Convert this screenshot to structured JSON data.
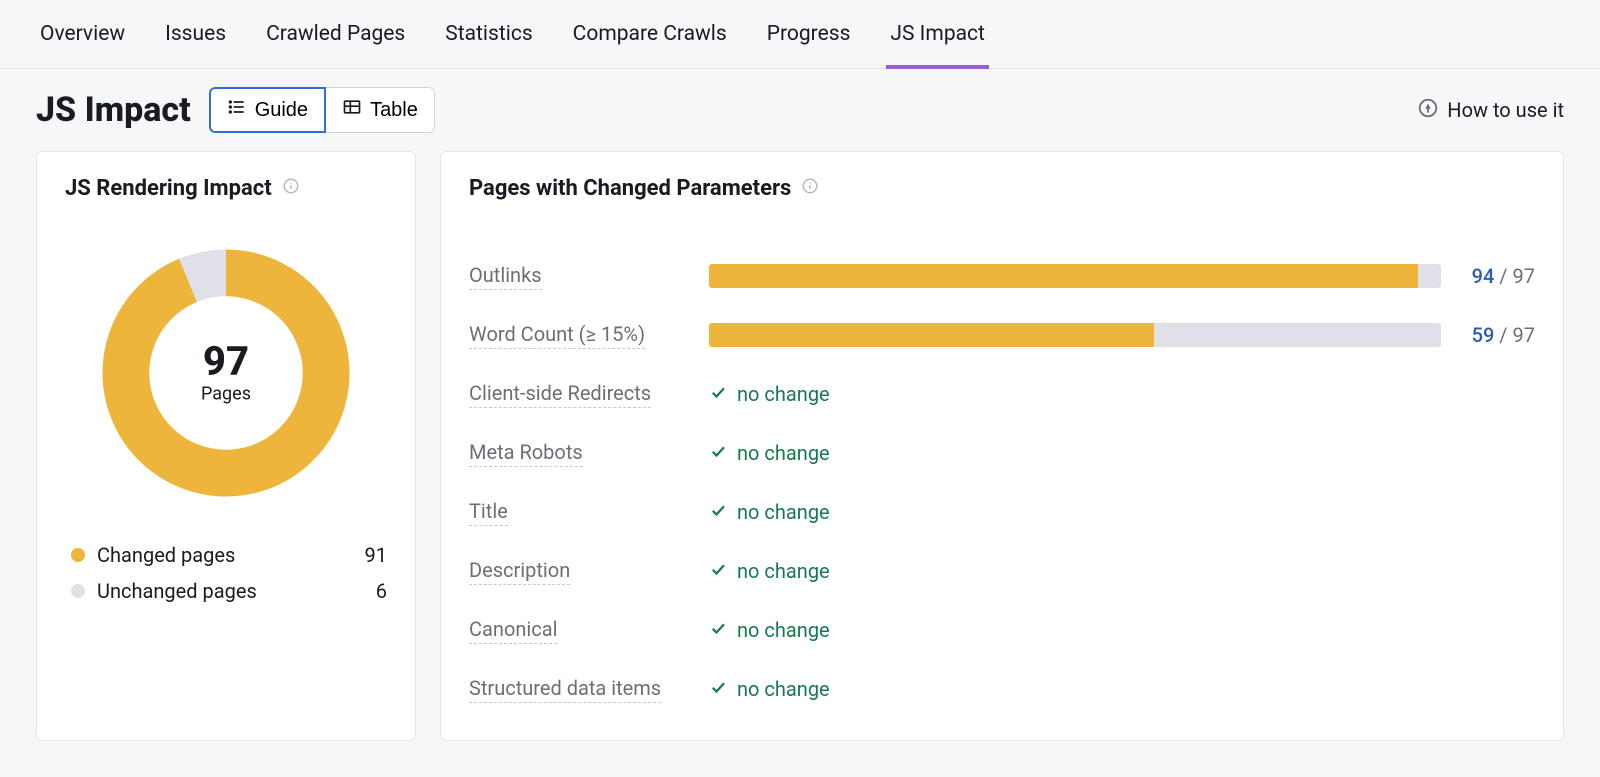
{
  "tabs": [
    {
      "label": "Overview"
    },
    {
      "label": "Issues"
    },
    {
      "label": "Crawled Pages"
    },
    {
      "label": "Statistics"
    },
    {
      "label": "Compare Crawls"
    },
    {
      "label": "Progress"
    },
    {
      "label": "JS Impact",
      "active": true
    }
  ],
  "header": {
    "title": "JS Impact",
    "view_guide": "Guide",
    "view_table": "Table",
    "how_to_use": "How to use it"
  },
  "left_card": {
    "title": "JS Rendering Impact",
    "total": "97",
    "total_label": "Pages",
    "legend": [
      {
        "label": "Changed pages",
        "value": "91",
        "color": "#eeb53d"
      },
      {
        "label": "Unchanged pages",
        "value": "6",
        "color": "#e0e1e8"
      }
    ]
  },
  "right_card": {
    "title": "Pages with Changed Parameters",
    "no_change_text": "no change",
    "params": [
      {
        "label": "Outlinks",
        "type": "bar",
        "value": 94,
        "total": 97
      },
      {
        "label": "Word Count (≥ 15%)",
        "type": "bar",
        "value": 59,
        "total": 97
      },
      {
        "label": "Client-side Redirects",
        "type": "nochange"
      },
      {
        "label": "Meta Robots",
        "type": "nochange"
      },
      {
        "label": "Title",
        "type": "nochange"
      },
      {
        "label": "Description",
        "type": "nochange"
      },
      {
        "label": "Canonical",
        "type": "nochange"
      },
      {
        "label": "Structured data items",
        "type": "nochange"
      }
    ]
  },
  "chart_data": {
    "type": "pie",
    "title": "JS Rendering Impact",
    "series": [
      {
        "name": "Changed pages",
        "value": 91,
        "color": "#eeb53d"
      },
      {
        "name": "Unchanged pages",
        "value": 6,
        "color": "#e0e1e8"
      }
    ],
    "total": 97,
    "inner_radius_ratio": 0.62
  }
}
